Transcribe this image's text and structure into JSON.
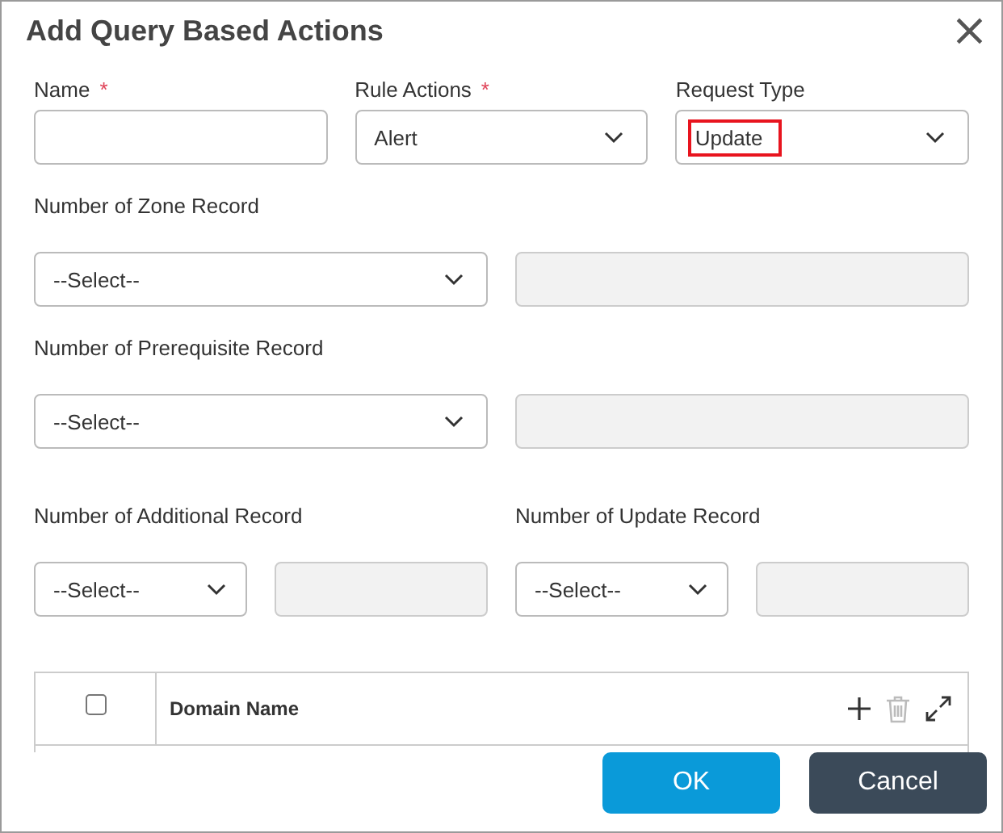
{
  "dialog": {
    "title": "Add Query Based Actions",
    "close_symbol": "×"
  },
  "top_fields": [
    {
      "label": "Name",
      "required_mark": "*",
      "kind": "input"
    },
    {
      "label": "Rule Actions",
      "required_mark": "*",
      "kind": "select",
      "value": "Alert"
    },
    {
      "label": "Request Type",
      "kind": "select",
      "value": "Update",
      "highlighted": true
    }
  ],
  "record_fields": [
    {
      "label": "Number of Zone Record",
      "select_value": "--Select--",
      "count_disabled": true,
      "kind": "wide"
    },
    {
      "label": "Number of Prerequisite Record",
      "select_value": "--Select--",
      "count_disabled": true,
      "kind": "wide"
    },
    {
      "label": "Number of Additional Record",
      "select_value": "--Select--",
      "count_disabled": true,
      "kind": "narrow"
    },
    {
      "label": "Number of Update Record",
      "select_value": "--Select--",
      "count_disabled": true,
      "kind": "narrow"
    }
  ],
  "table": {
    "header_checked": false,
    "columns": [
      {
        "label": "Domain Name"
      }
    ]
  },
  "buttons": [
    {
      "label": "OK",
      "kind": "primary"
    },
    {
      "label": "Cancel",
      "kind": "secondary"
    }
  ]
}
